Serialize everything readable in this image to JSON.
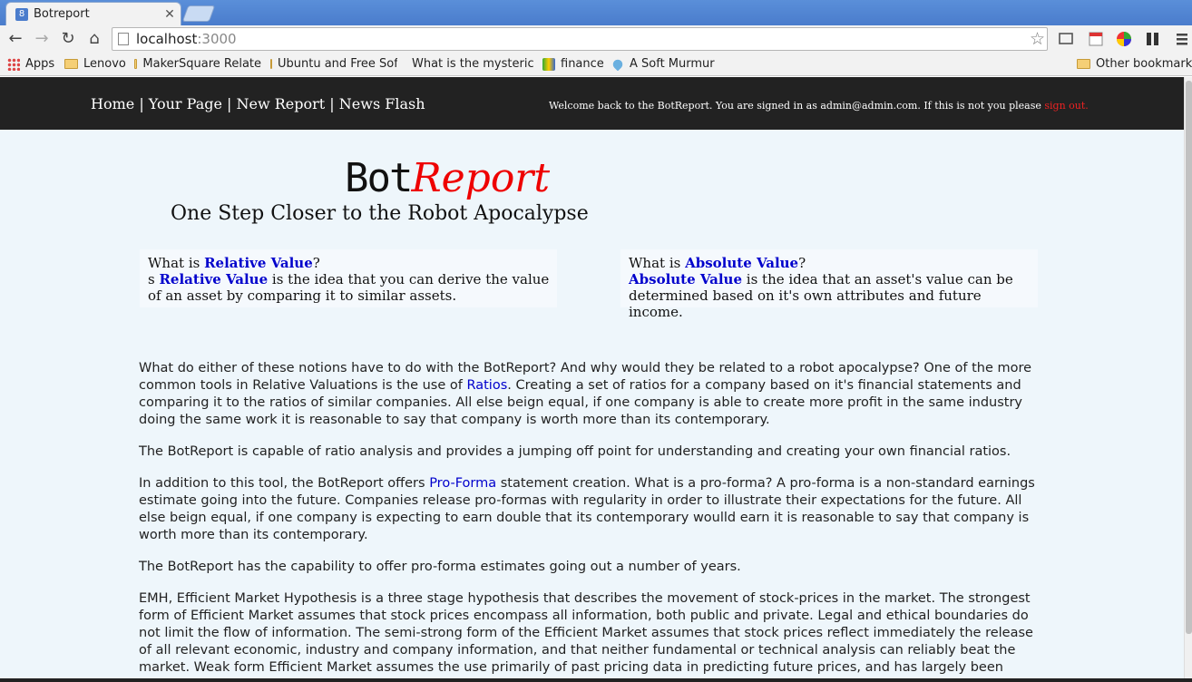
{
  "browser": {
    "tab_title": "Botreport",
    "tab_favicon": "8",
    "url_host": "localhost",
    "url_port": ":3000",
    "bookmarks": [
      "Apps",
      "Lenovo",
      "MakerSquare Relate",
      "Ubuntu and Free Sof",
      "What is the mysteric",
      "finance",
      "A Soft Murmur"
    ],
    "other_bookmarks": "Other bookmarks"
  },
  "site_nav": {
    "home": "Home",
    "your_page": "Your Page",
    "new_report": "New Report",
    "news_flash": "News Flash",
    "separator": " | ",
    "welcome_text": "Welcome back to the BotReport. You are signed in as admin@admin.com. If this is not you please ",
    "sign_out": "sign out."
  },
  "hero": {
    "logo_bot": "Bot",
    "logo_report": "Report",
    "tagline": "One Step Closer to the Robot Apocalypse"
  },
  "cards": {
    "relative": {
      "q_prefix": "What is ",
      "term": "Relative Value",
      "q_suffix": "?",
      "body_prefix": "s ",
      "body": " is the idea that you can derive the value of an asset by comparing it to similar assets."
    },
    "absolute": {
      "q_prefix": "What is ",
      "term": "Absolute Value",
      "q_suffix": "?",
      "body": " is the idea that an asset's value can be determined based on it's own attributes and future income."
    }
  },
  "article": {
    "p1_a": "What do either of these notions have to do with the BotReport? And why would they be related to a robot apocalypse? One of the more common tools in Relative Valuations is the use of ",
    "p1_link": "Ratios",
    "p1_b": ". Creating a set of ratios for a company based on it's financial statements and comparing it to the ratios of similar companies. All else beign equal, if one company is able to create more profit in the same industry doing the same work it is reasonable to say that company is worth more than its contemporary.",
    "p2": "The BotReport is capable of ratio analysis and provides a jumping off point for understanding and creating your own financial ratios.",
    "p3_a": "In addition to this tool, the BotReport offers ",
    "p3_link": "Pro-Forma",
    "p3_b": " statement creation. What is a pro-forma? A pro-forma is a non-standard earnings estimate going into the future. Companies release pro-formas with regularity in order to illustrate their expectations for the future. All else beign equal, if one company is expecting to earn double that its contemporary woulld earn it is reasonable to say that company is worth more than its contemporary.",
    "p4": "The BotReport has the capability to offer pro-forma estimates going out a number of years.",
    "p5": "EMH, Efficient Market Hypothesis is a three stage hypothesis that describes the movement of stock-prices in the market. The strongest form of Efficient Market assumes that stock prices encompass all information, both public and private. Legal and ethical boundaries do not limit the flow of information. The semi-strong form of the Efficient Market assumes that stock prices reflect immediately the release of all relevant economic, industry and company information, and that neither fundamental or technical analysis can reliably beat the market. Weak form Efficient Market assumes the use primarily of past pricing data in predicting future prices, and has largely been"
  }
}
